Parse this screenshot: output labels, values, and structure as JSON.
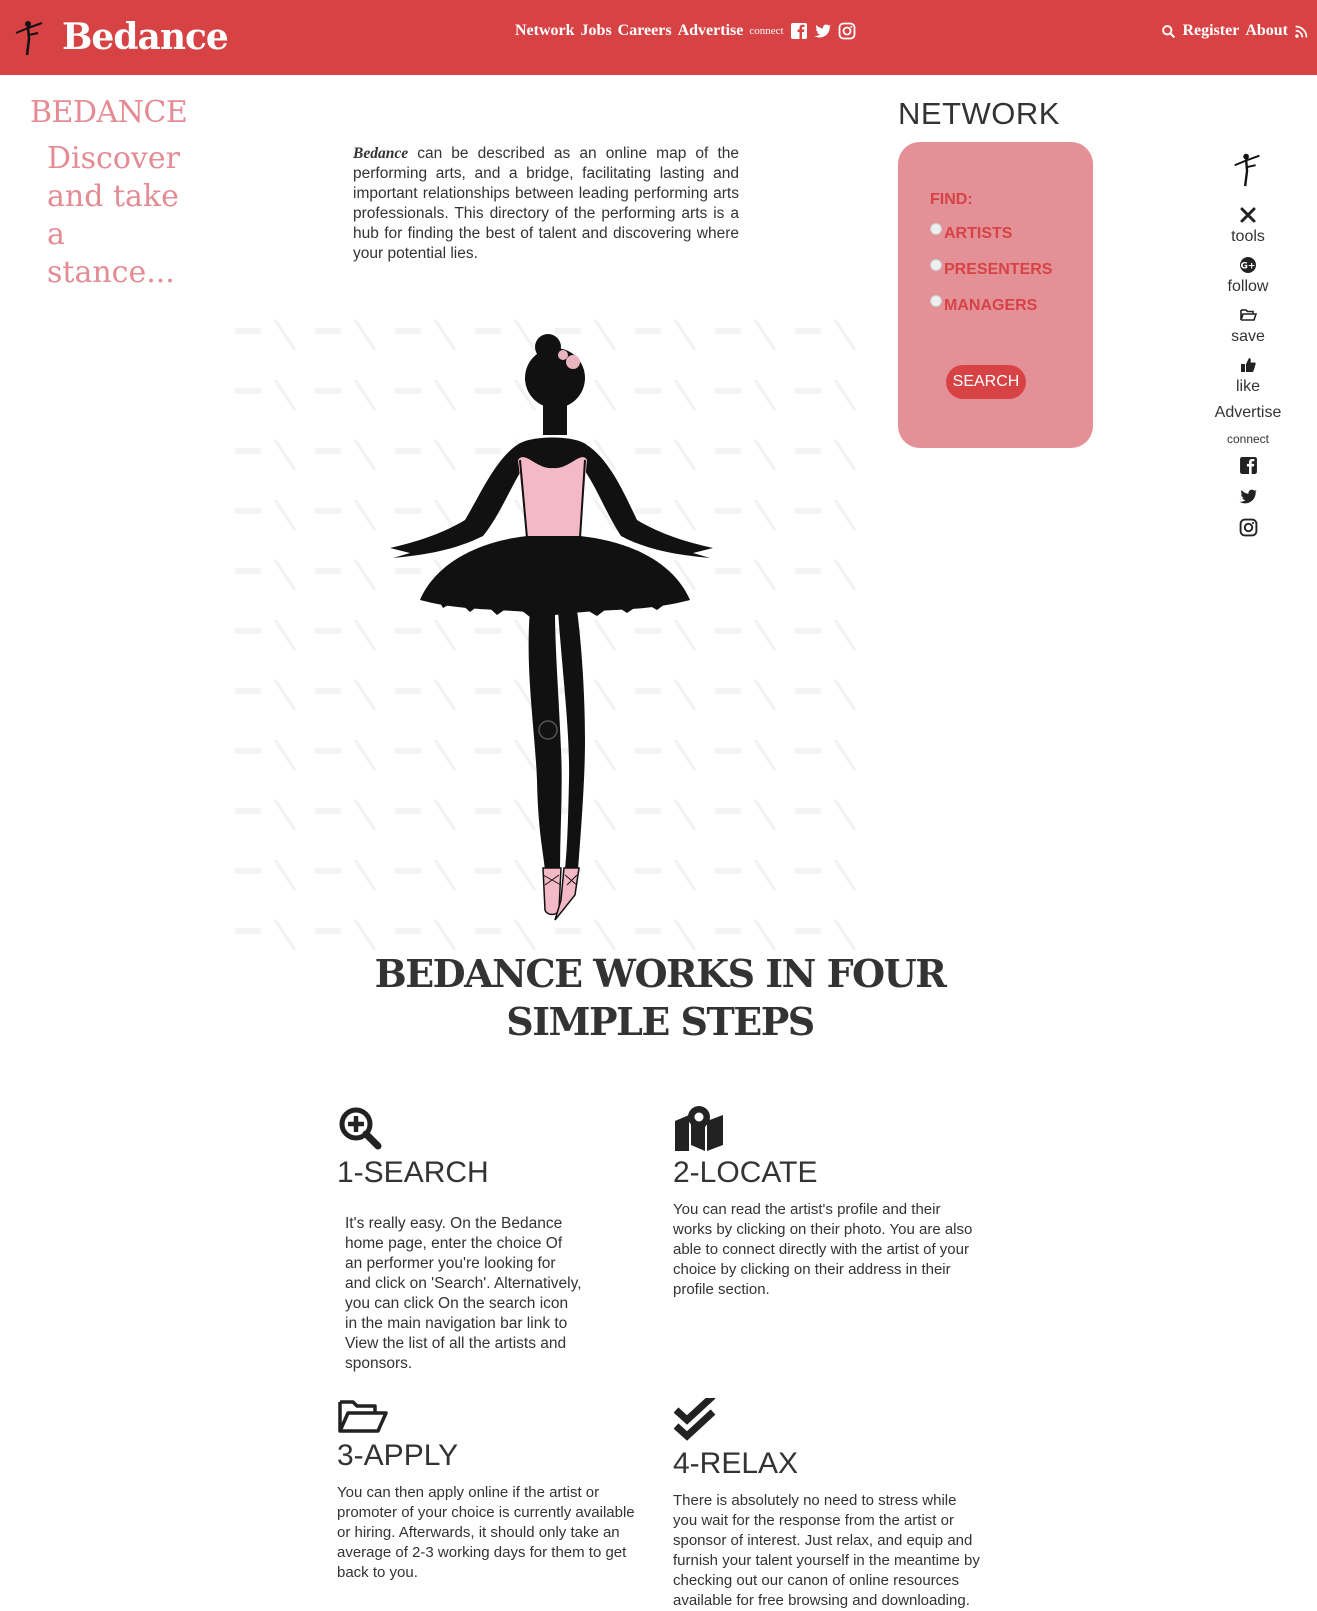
{
  "header": {
    "brand": "Bedance",
    "nav": [
      "Network",
      "Jobs",
      "Careers",
      "Advertise"
    ],
    "connect_label": "connect",
    "register_label": "Register",
    "about_label": "About"
  },
  "left": {
    "title": "BEDANCE",
    "tagline": "Discover and take a stance..."
  },
  "intro": {
    "brand": "Bedance",
    "text": " can be described as an online map of the performing arts, and a bridge, facilitating lasting and important relationships between leading performing arts professionals. This directory of the performing arts is a hub for finding the best of talent and discovering where your potential lies."
  },
  "network": {
    "title": "NETWORK",
    "find_label": "FIND:",
    "options": [
      "ARTISTS",
      "PRESENTERS",
      "MANAGERS"
    ],
    "search_label": "SEARCH"
  },
  "rail": {
    "items": [
      "tools",
      "follow",
      "save",
      "like"
    ],
    "advertise": "Advertise",
    "connect": "connect"
  },
  "steps": {
    "title": "BEDANCE WORKS IN FOUR SIMPLE STEPS",
    "items": [
      {
        "heading": "1-SEARCH",
        "text": "It's really easy. On the Bedance home page, enter the choice Of an performer you're looking for and click on 'Search'. Alternatively, you can click On the search icon in the main navigation bar link to View the list of all the artists and sponsors."
      },
      {
        "heading": "2-LOCATE",
        "text": "You can read the artist's profile and their works by clicking on their photo. You are also able to connect directly with the artist of your choice by clicking on their address in their profile section."
      },
      {
        "heading": "3-APPLY",
        "text": "You can then apply online if the artist or promoter of your choice is currently available or hiring. Afterwards, it should only take an average of 2-3 working days for them to get back to you."
      },
      {
        "heading": "4-RELAX",
        "text": "There is absolutely no need to stress while you wait for the response from the artist or sponsor of interest. Just relax, and equip and furnish your talent yourself in the meantime by checking out our canon of online resources available for free browsing and downloading."
      }
    ]
  },
  "colors": {
    "brand_red": "#d74345",
    "panel_pink": "#e39097",
    "accent_pink": "#e48b94",
    "text_dark": "#333333"
  }
}
